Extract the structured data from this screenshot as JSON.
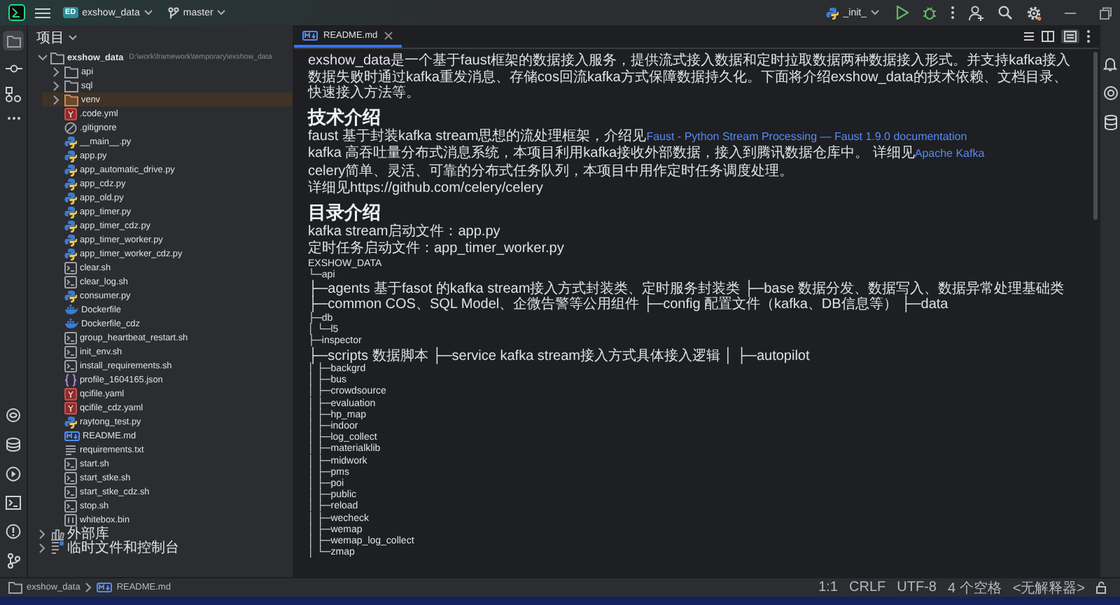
{
  "title_bar": {
    "project_badge": "ED",
    "project": "exshow_data",
    "branch": "master",
    "run_config": "_init_"
  },
  "project_panel": {
    "title": "项目",
    "active": true,
    "tree": [
      {
        "name": "exshow_data",
        "path": "D:\\work\\framework\\temporary\\exshow_data",
        "kind": "folder",
        "expanded": true,
        "selected": false,
        "children": [
          {
            "name": "api",
            "kind": "folder",
            "expanded": false,
            "selected": false
          },
          {
            "name": "sql",
            "kind": "folder",
            "expanded": false,
            "selected": false
          },
          {
            "name": "venv",
            "kind": "excluded_folder",
            "expanded": false,
            "selected": true
          },
          {
            "name": ".code.yml",
            "kind": "yaml",
            "selected": false
          },
          {
            "name": ".gitignore",
            "kind": "ignore",
            "selected": false
          },
          {
            "name": "__main__.py",
            "kind": "python",
            "selected": false
          },
          {
            "name": "app.py",
            "kind": "python",
            "selected": false
          },
          {
            "name": "app_automatic_drive.py",
            "kind": "python",
            "selected": false
          },
          {
            "name": "app_cdz.py",
            "kind": "python",
            "selected": false
          },
          {
            "name": "app_old.py",
            "kind": "python",
            "selected": false
          },
          {
            "name": "app_timer.py",
            "kind": "python",
            "selected": false
          },
          {
            "name": "app_timer_cdz.py",
            "kind": "python",
            "selected": false
          },
          {
            "name": "app_timer_worker.py",
            "kind": "python",
            "selected": false
          },
          {
            "name": "app_timer_worker_cdz.py",
            "kind": "python",
            "selected": false
          },
          {
            "name": "clear.sh",
            "kind": "shell",
            "selected": false
          },
          {
            "name": "clear_log.sh",
            "kind": "shell",
            "selected": false
          },
          {
            "name": "consumer.py",
            "kind": "python",
            "selected": false
          },
          {
            "name": "Dockerfile",
            "kind": "docker",
            "selected": false
          },
          {
            "name": "Dockerfile_cdz",
            "kind": "docker",
            "selected": false
          },
          {
            "name": "group_heartbeat_restart.sh",
            "kind": "shell",
            "selected": false
          },
          {
            "name": "init_env.sh",
            "kind": "shell",
            "selected": false
          },
          {
            "name": "install_requirements.sh",
            "kind": "shell",
            "selected": false
          },
          {
            "name": "profile_1604165.json",
            "kind": "json",
            "selected": false
          },
          {
            "name": "qcifile.yaml",
            "kind": "yaml",
            "selected": false
          },
          {
            "name": "qcifile_cdz.yaml",
            "kind": "yaml",
            "selected": false
          },
          {
            "name": "raytong_test.py",
            "kind": "python",
            "selected": false
          },
          {
            "name": "README.md",
            "kind": "markdown",
            "selected": false
          },
          {
            "name": "requirements.txt",
            "kind": "text",
            "selected": false
          },
          {
            "name": "start.sh",
            "kind": "shell",
            "selected": false
          },
          {
            "name": "start_stke.sh",
            "kind": "shell",
            "selected": false
          },
          {
            "name": "start_stke_cdz.sh",
            "kind": "shell",
            "selected": false
          },
          {
            "name": "stop.sh",
            "kind": "shell",
            "selected": false
          },
          {
            "name": "whitebox.bin",
            "kind": "binary",
            "selected": false
          }
        ]
      },
      {
        "name": "外部库",
        "kind": "library",
        "expanded": false,
        "selected": false
      },
      {
        "name": "临时文件和控制台",
        "kind": "scratch",
        "expanded": false,
        "selected": false
      }
    ]
  },
  "tabs": [
    {
      "label": "README.md",
      "selected": true
    }
  ],
  "document": [
    {
      "kind": "paragraph",
      "text": "exshow_data是一个基于faust框架的数据接入服务，提供流式接入数据和定时拉取数据两种数据接入形式。并支持kafka接入数据失败时通过kafka重发消息、存储cos回流kafka方式保障数据持久化。下面将介绍exshow_data的技术依赖、文档目录、快速接入方法等。"
    },
    {
      "kind": "heading",
      "text": "技术介绍"
    },
    {
      "kind": "paragraph",
      "text": "faust 基于封装kafka stream思想的流处理框架，介绍见",
      "link": "Faust - Python Stream Processing — Faust 1.9.0 documentation"
    },
    {
      "kind": "paragraph",
      "text": "kafka 高吞吐量分布式消息系统，本项目利用kafka接收外部数据，接入到腾讯数据仓库中。 详细见",
      "link": "Apache Kafka"
    },
    {
      "kind": "paragraph",
      "text": "celery简单、灵活、可靠的分布式任务队列，本项目中用作定时任务调度处理。"
    },
    {
      "kind": "paragraph",
      "text": "详细见https://github.com/celery/celery"
    },
    {
      "kind": "heading",
      "text": "目录介绍"
    },
    {
      "kind": "paragraph",
      "text": "kafka stream启动文件：app.py"
    },
    {
      "kind": "paragraph",
      "text": "定时任务启动文件：app_timer_worker.py"
    },
    {
      "kind": "line",
      "text": "EXSHOW_DATA"
    },
    {
      "kind": "line",
      "text": "└─api"
    },
    {
      "kind": "line",
      "text": "├─agents 基于fasot 的kafka stream接入方式封装类、定时服务封装类 ├─base 数据分发、数据写入、数据异常处理基础类 ├─common COS、SQL Model、企微告警等公用组件 ├─config 配置文件（kafka、DB信息等） ├─data"
    },
    {
      "kind": "line",
      "text": "├─db"
    },
    {
      "kind": "line",
      "text": "│ └─l5"
    },
    {
      "kind": "line",
      "text": "├─inspector"
    },
    {
      "kind": "line",
      "text": "├─scripts 数据脚本 ├─service kafka stream接入方式具体接入逻辑 │ ├─autopilot"
    },
    {
      "kind": "line",
      "text": "│ ├─backgrd"
    },
    {
      "kind": "line",
      "text": "│ ├─bus"
    },
    {
      "kind": "line",
      "text": "│ ├─crowdsource"
    },
    {
      "kind": "line",
      "text": "│ ├─evaluation"
    },
    {
      "kind": "line",
      "text": "│ ├─hp_map"
    },
    {
      "kind": "line",
      "text": "│ ├─indoor"
    },
    {
      "kind": "line",
      "text": "│ ├─log_collect"
    },
    {
      "kind": "line",
      "text": "│ ├─materialklib"
    },
    {
      "kind": "line",
      "text": "│ ├─midwork"
    },
    {
      "kind": "line",
      "text": "│ ├─pms"
    },
    {
      "kind": "line",
      "text": "│ ├─poi"
    },
    {
      "kind": "line",
      "text": "│ ├─public"
    },
    {
      "kind": "line",
      "text": "│ ├─reload"
    },
    {
      "kind": "line",
      "text": "│ ├─wecheck"
    },
    {
      "kind": "line",
      "text": "│ ├─wemap"
    },
    {
      "kind": "line",
      "text": "│ ├─wemap_log_collect"
    },
    {
      "kind": "line",
      "text": "│ └─zmap"
    }
  ],
  "status_bar": {
    "breadcrumb": [
      "exshow_data",
      "README.md"
    ],
    "position": "1:1",
    "line_ending": "CRLF",
    "encoding": "UTF-8",
    "indent": "4 个空格",
    "interpreter": "<无解释器>"
  }
}
